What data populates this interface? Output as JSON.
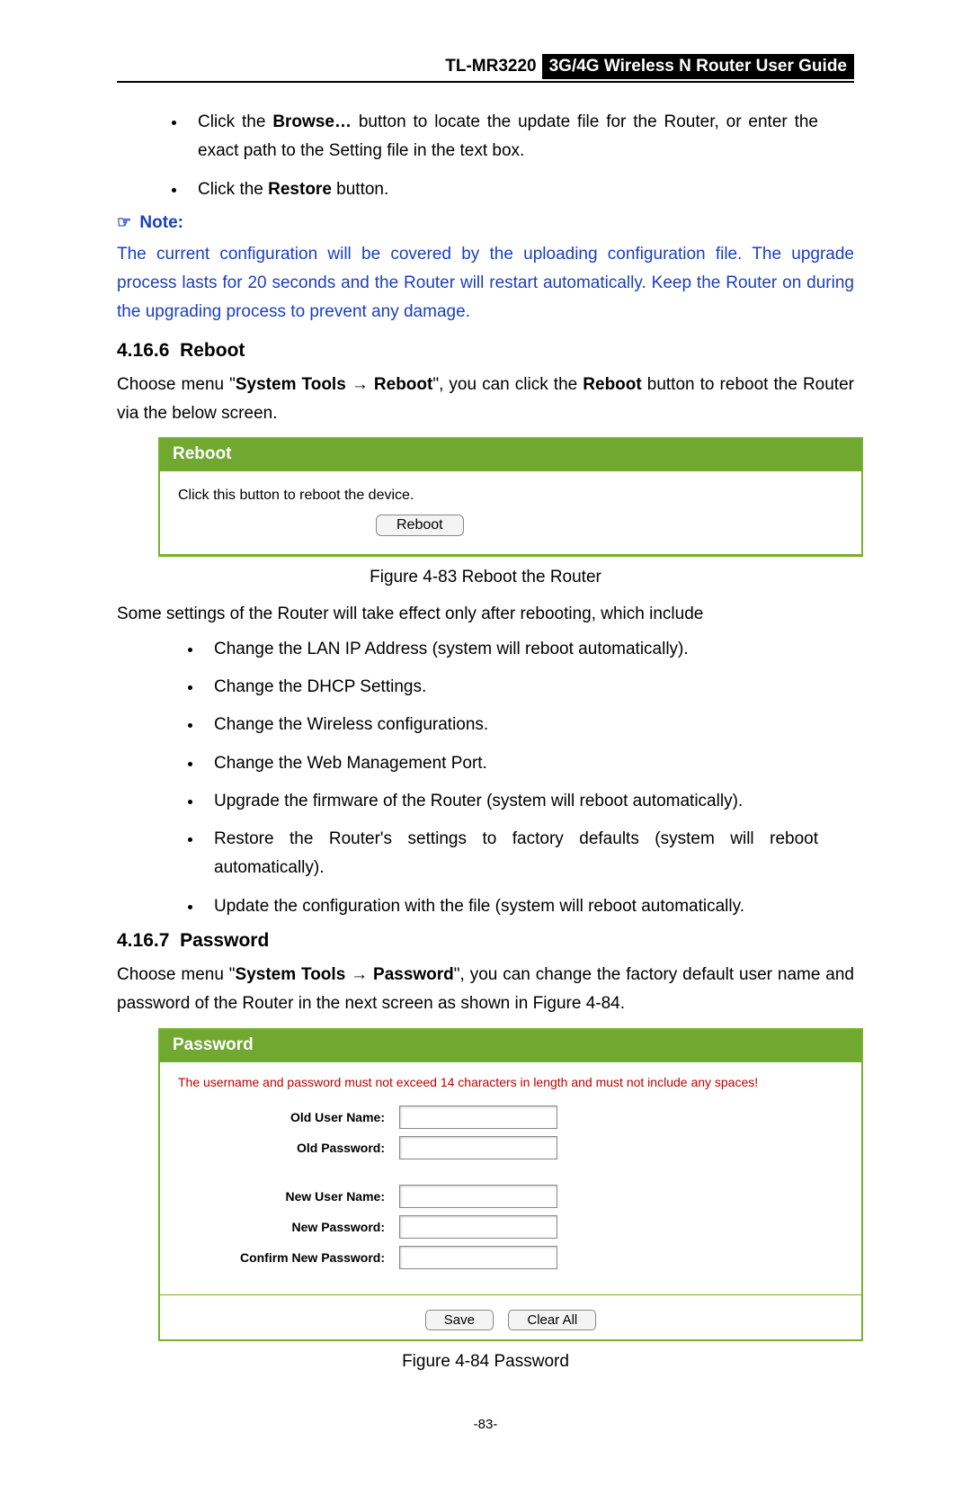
{
  "header": {
    "model": "TL-MR3220",
    "title": "3G/4G Wireless N Router User Guide"
  },
  "top_bullets": [
    {
      "pre": "Click the ",
      "b1": "Browse…",
      "mid": " button to locate the update file for the Router, or enter the exact path to the Setting file in the text box."
    },
    {
      "pre": "Click the ",
      "b1": "Restore",
      "mid": " button."
    }
  ],
  "note": {
    "label": "Note:"
  },
  "blue_para": "The current configuration will be covered by the uploading configuration file. The upgrade process lasts for 20 seconds and the Router will restart automatically. Keep the Router on during the upgrading process to prevent any damage.",
  "sec_reboot": {
    "num": "4.16.6",
    "title": "Reboot"
  },
  "reboot_para": {
    "pre": "Choose menu \"",
    "b1": "System Tools",
    "arrow": " → ",
    "b2": "Reboot",
    "mid": "\", you can click the ",
    "b3": "Reboot",
    "post": " button to reboot the Router via the below screen."
  },
  "reboot_panel": {
    "title": "Reboot",
    "desc": "Click this button to reboot the device.",
    "button": "Reboot"
  },
  "fig83": "Figure 4-83 Reboot the Router",
  "effect_para": "Some settings of the Router will take effect only after rebooting, which include",
  "effect_bullets": [
    "Change the LAN IP Address (system will reboot automatically).",
    "Change the DHCP Settings.",
    "Change the Wireless configurations.",
    "Change the Web Management Port.",
    "Upgrade the firmware of the Router (system will reboot automatically).",
    "Restore the Router's settings to factory defaults (system will reboot automatically).",
    "Update the configuration with the file (system will reboot automatically."
  ],
  "sec_password": {
    "num": "4.16.7",
    "title": "Password"
  },
  "password_para": {
    "pre": "Choose menu \"",
    "b1": "System Tools",
    "arrow": " → ",
    "b2": "Password",
    "post": "\", you can change the factory default user name and password of the Router in the next screen as shown in Figure 4-84."
  },
  "password_panel": {
    "title": "Password",
    "warning": "The username and password must not exceed 14 characters in length and must not include any spaces!",
    "labels": {
      "old_user": "Old User Name:",
      "old_pass": "Old Password:",
      "new_user": "New User Name:",
      "new_pass": "New Password:",
      "confirm": "Confirm New Password:"
    },
    "buttons": {
      "save": "Save",
      "clear": "Clear All"
    }
  },
  "fig84": "Figure 4-84    Password",
  "page_num": "-83-"
}
